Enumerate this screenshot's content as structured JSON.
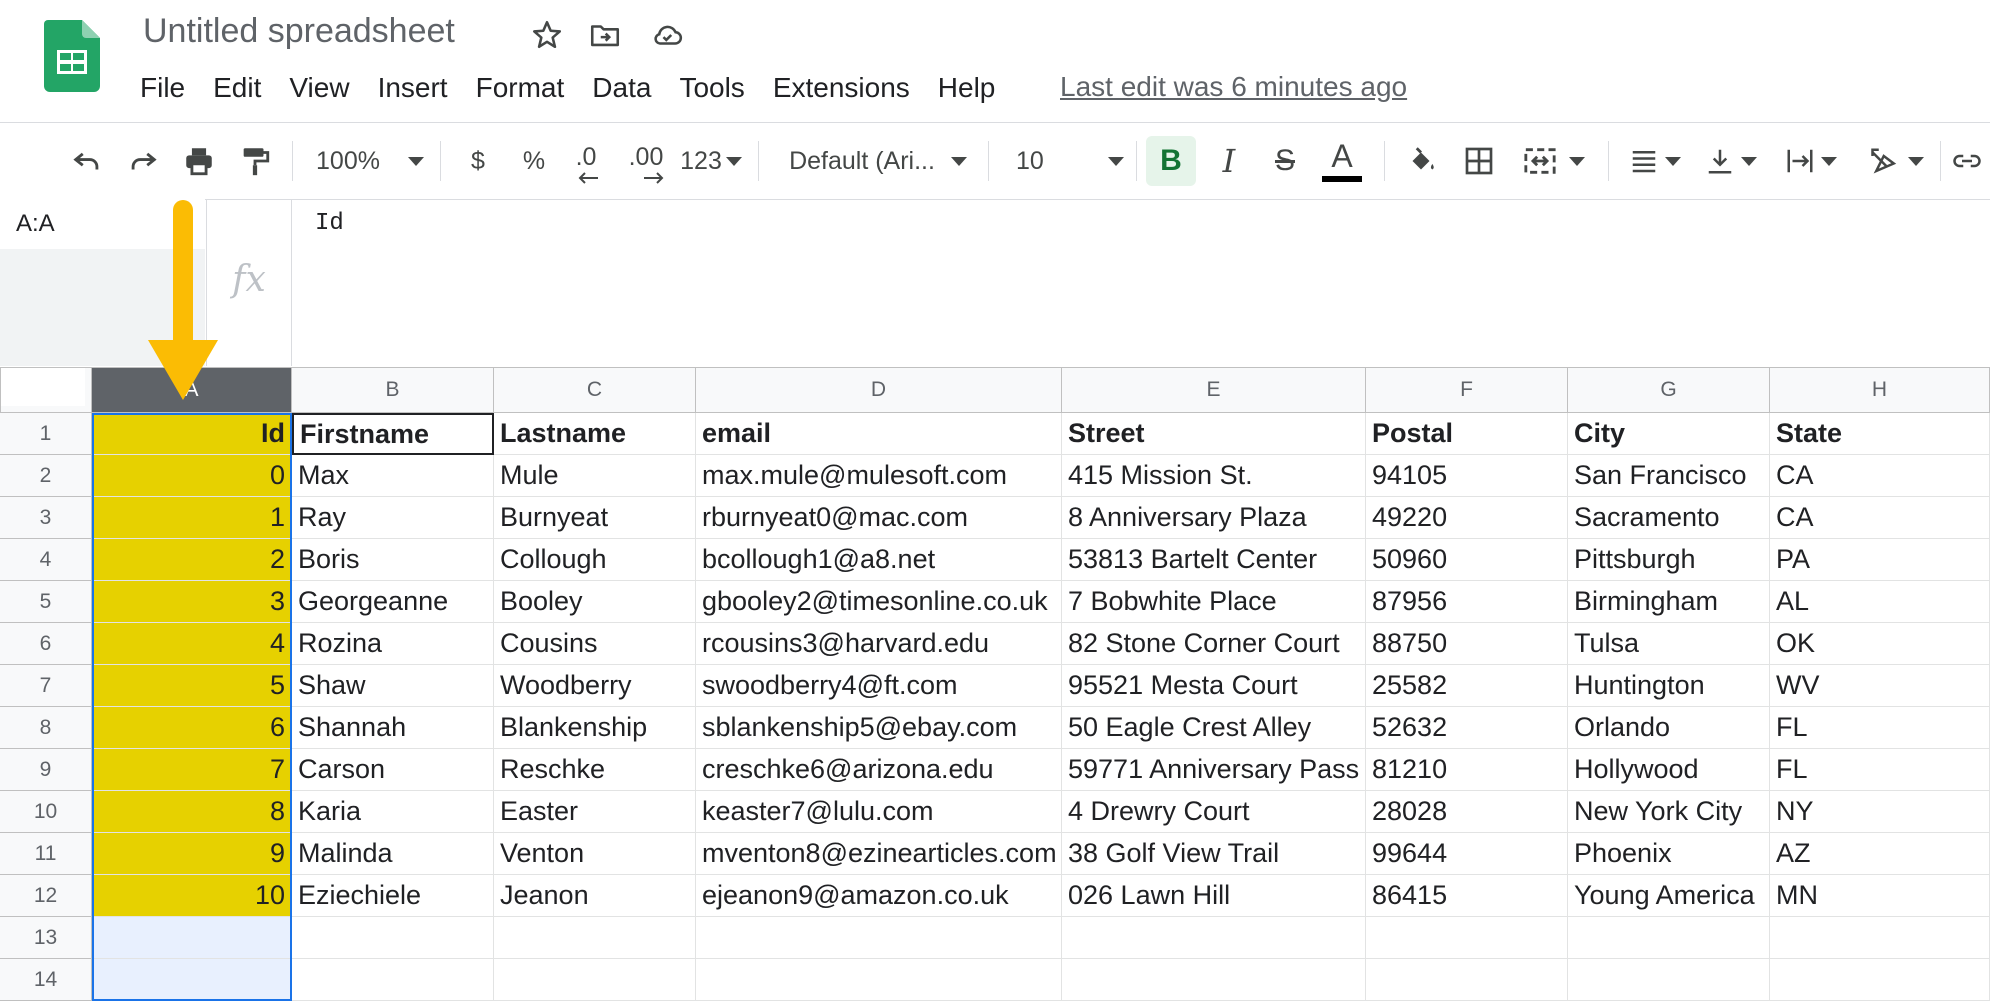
{
  "header": {
    "title": "Untitled spreadsheet",
    "menu": [
      "File",
      "Edit",
      "View",
      "Insert",
      "Format",
      "Data",
      "Tools",
      "Extensions",
      "Help"
    ],
    "last_edit": "Last edit was 6 minutes ago"
  },
  "toolbar": {
    "zoom": "100%",
    "currency": "$",
    "percent": "%",
    "decrease_decimal": ".0",
    "increase_decimal": ".00",
    "number_format": "123",
    "font": "Default (Ari...",
    "font_size": "10",
    "bold": "B",
    "italic": "I",
    "strikethrough": "S",
    "text_color_label": "A"
  },
  "formula_bar": {
    "name_box": "A:A",
    "fx": "fx",
    "content": "Id"
  },
  "colors": {
    "highlight": "#e6d100",
    "selected_header": "#5f6368",
    "arrow": "#fbbc04"
  },
  "sheet": {
    "columns": [
      "A",
      "B",
      "C",
      "D",
      "E",
      "F",
      "G",
      "H"
    ],
    "row_numbers": [
      "1",
      "2",
      "3",
      "4",
      "5",
      "6",
      "7",
      "8",
      "9",
      "10",
      "11",
      "12",
      "13",
      "14"
    ],
    "rows": [
      [
        "Id",
        "Firstname",
        "Lastname",
        "email",
        "Street",
        "Postal",
        "City",
        "State"
      ],
      [
        "0",
        "Max",
        "Mule",
        "max.mule@mulesoft.com",
        "415 Mission St.",
        "94105",
        "San Francisco",
        "CA"
      ],
      [
        "1",
        "Ray",
        "Burnyeat",
        "rburnyeat0@mac.com",
        "8 Anniversary Plaza",
        "49220",
        "Sacramento",
        "CA"
      ],
      [
        "2",
        "Boris",
        "Collough",
        "bcollough1@a8.net",
        "53813 Bartelt Center",
        "50960",
        "Pittsburgh",
        "PA"
      ],
      [
        "3",
        "Georgeanne",
        "Booley",
        "gbooley2@timesonline.co.uk",
        "7 Bobwhite Place",
        "87956",
        "Birmingham",
        "AL"
      ],
      [
        "4",
        "Rozina",
        "Cousins",
        "rcousins3@harvard.edu",
        "82 Stone Corner Court",
        "88750",
        "Tulsa",
        "OK"
      ],
      [
        "5",
        "Shaw",
        "Woodberry",
        "swoodberry4@ft.com",
        "95521 Mesta Court",
        "25582",
        "Huntington",
        "WV"
      ],
      [
        "6",
        "Shannah",
        "Blankenship",
        "sblankenship5@ebay.com",
        "50 Eagle Crest Alley",
        "52632",
        "Orlando",
        "FL"
      ],
      [
        "7",
        "Carson",
        "Reschke",
        "creschke6@arizona.edu",
        "59771 Anniversary Pass",
        "81210",
        "Hollywood",
        "FL"
      ],
      [
        "8",
        "Karia",
        "Easter",
        "keaster7@lulu.com",
        "4 Drewry Court",
        "28028",
        "New York City",
        "NY"
      ],
      [
        "9",
        "Malinda",
        "Venton",
        "mventon8@ezinearticles.com",
        "38 Golf View Trail",
        "99644",
        "Phoenix",
        "AZ"
      ],
      [
        "10",
        "Eziechiele",
        "Jeanon",
        "ejeanon9@amazon.co.uk",
        "026 Lawn Hill",
        "86415",
        "Young America",
        "MN"
      ],
      [
        "",
        "",
        "",
        "",
        "",
        "",
        "",
        ""
      ],
      [
        "",
        "",
        "",
        "",
        "",
        "",
        "",
        ""
      ]
    ]
  }
}
